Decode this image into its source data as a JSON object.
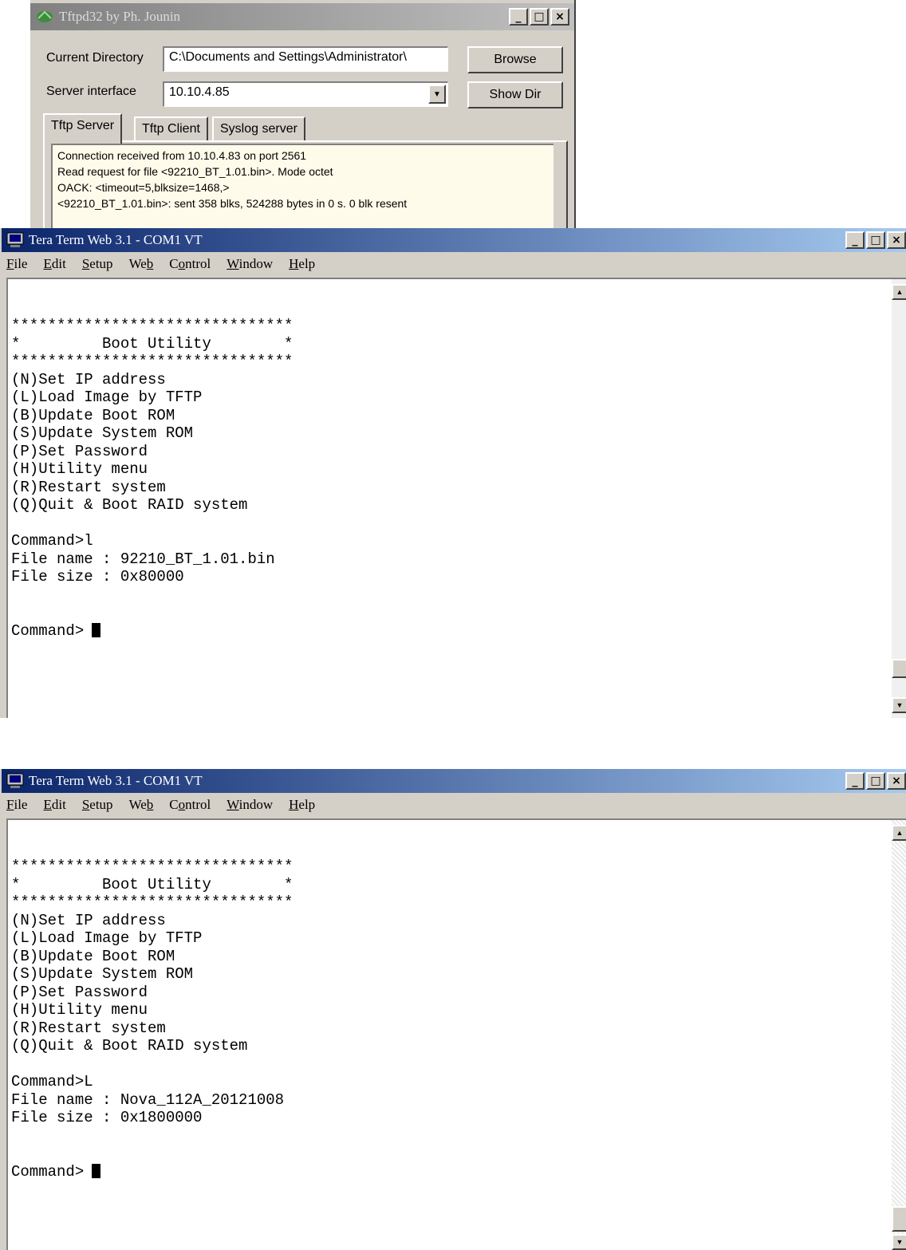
{
  "tftpd": {
    "title": "Tftpd32 by Ph. Jounin",
    "current_directory_label": "Current Directory",
    "current_directory_value": "C:\\Documents and Settings\\Administrator\\",
    "server_interface_label": "Server interface",
    "server_interface_value": "10.10.4.85",
    "browse_label": "Browse",
    "show_dir_label": "Show Dir",
    "tabs": [
      {
        "label": "Tftp Server"
      },
      {
        "label": "Tftp Client"
      },
      {
        "label": "Syslog server"
      }
    ],
    "log_lines": [
      "Connection received from 10.10.4.83 on port 2561",
      "Read request for file <92210_BT_1.01.bin>. Mode octet",
      "OACK: <timeout=5,blksize=1468,>",
      "<92210_BT_1.01.bin>: sent 358 blks, 524288 bytes in 0 s. 0 blk resent"
    ]
  },
  "teraterm_top": {
    "title": "Tera Term Web 3.1 - COM1 VT",
    "menu": [
      {
        "label": "File",
        "key": "F"
      },
      {
        "label": "Edit",
        "key": "E"
      },
      {
        "label": "Setup",
        "key": "S"
      },
      {
        "label": "Web",
        "key": "b"
      },
      {
        "label": "Control",
        "key": "o"
      },
      {
        "label": "Window",
        "key": "W"
      },
      {
        "label": "Help",
        "key": "H"
      }
    ],
    "terminal_lines": [
      "*******************************",
      "*         Boot Utility        *",
      "*******************************",
      "(N)Set IP address",
      "(L)Load Image by TFTP",
      "(B)Update Boot ROM",
      "(S)Update System ROM",
      "(P)Set Password",
      "(H)Utility menu",
      "(R)Restart system",
      "(Q)Quit & Boot RAID system",
      "",
      "Command>l",
      "File name : 92210_BT_1.01.bin",
      "File size : 0x80000"
    ],
    "prompt": "Command>"
  },
  "teraterm_bottom": {
    "title": "Tera Term Web 3.1 - COM1 VT",
    "menu": [
      {
        "label": "File",
        "key": "F"
      },
      {
        "label": "Edit",
        "key": "E"
      },
      {
        "label": "Setup",
        "key": "S"
      },
      {
        "label": "Web",
        "key": "b"
      },
      {
        "label": "Control",
        "key": "o"
      },
      {
        "label": "Window",
        "key": "W"
      },
      {
        "label": "Help",
        "key": "H"
      }
    ],
    "terminal_lines": [
      "*******************************",
      "*         Boot Utility        *",
      "*******************************",
      "(N)Set IP address",
      "(L)Load Image by TFTP",
      "(B)Update Boot ROM",
      "(S)Update System ROM",
      "(P)Set Password",
      "(H)Utility menu",
      "(R)Restart system",
      "(Q)Quit & Boot RAID system",
      "",
      "Command>L",
      "File name : Nova_112A_20121008",
      "File size : 0x1800000"
    ],
    "prompt": "Command>"
  }
}
